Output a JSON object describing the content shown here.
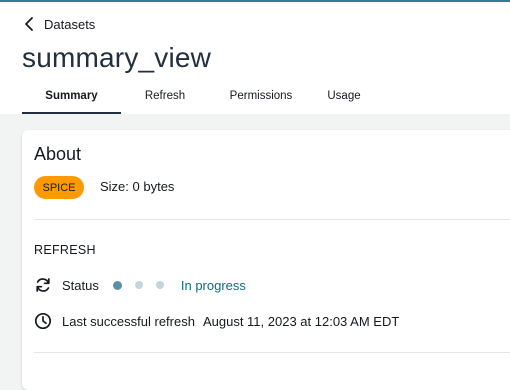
{
  "breadcrumb": {
    "back_label": "Datasets"
  },
  "page": {
    "title": "summary_view"
  },
  "tabs": [
    {
      "label": "Summary",
      "active": true
    },
    {
      "label": "Refresh",
      "active": false
    },
    {
      "label": "Permissions",
      "active": false
    },
    {
      "label": "Usage",
      "active": false
    }
  ],
  "about": {
    "title": "About",
    "badge": "SPICE",
    "size": "Size: 0 bytes"
  },
  "refresh": {
    "heading": "REFRESH",
    "status_label": "Status",
    "status_value": "In progress",
    "last_label": "Last successful refresh",
    "last_value": "August 11, 2023 at 12:03 AM EDT"
  },
  "icons": {
    "back": "chevron-left-icon",
    "status": "refresh-icon",
    "last_refresh": "clock-icon"
  },
  "colors": {
    "top_accent": "#2f7f92",
    "badge_bg": "#ff9900",
    "status_link": "#0f6b82",
    "dot_active": "#5b8fa8",
    "dot_inactive": "#c3d6e0"
  }
}
